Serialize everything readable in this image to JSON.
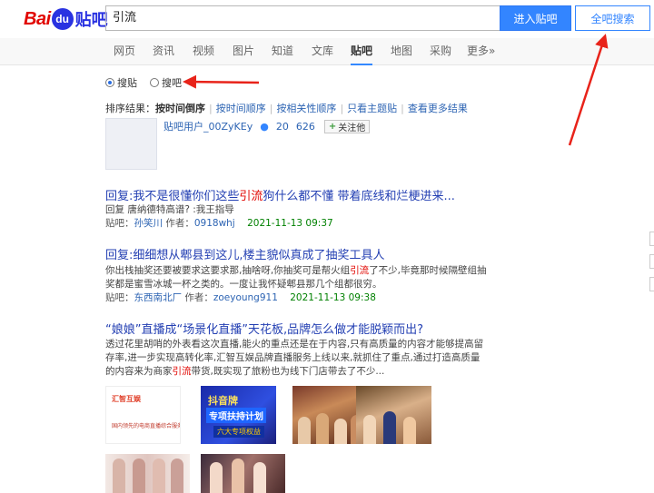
{
  "header": {
    "logo_left": "Bai",
    "logo_paw": "du",
    "logo_right": "贴吧",
    "search_value": "引流",
    "search_button": "进入贴吧",
    "all_search_button": "全吧搜索"
  },
  "nav": {
    "items": [
      "网页",
      "资讯",
      "视频",
      "图片",
      "知道",
      "文库",
      "贴吧",
      "地图",
      "采购",
      "更多»"
    ],
    "active": "贴吧"
  },
  "radios": [
    {
      "label": "搜贴",
      "checked": true
    },
    {
      "label": "搜吧",
      "checked": false
    }
  ],
  "sort": {
    "label": "排序结果：",
    "current": "按时间倒序",
    "links": [
      "按时间顺序",
      "按相关性顺序",
      "只看主题贴",
      "查看更多结果"
    ]
  },
  "user": {
    "name": "贴吧用户_00ZyKEy",
    "count1": "20",
    "count2": "626",
    "follow": "关注他"
  },
  "results": [
    {
      "title_pre": "回复:我不是很懂你们这些",
      "title_hl": "引流",
      "title_post": "狗什么都不懂 带着底线和烂梗进来...",
      "snippet": "回复 唐纳德特高谱? :我王指导",
      "meta_prefix": "贴吧：",
      "forum": "孙笑川",
      "author_prefix": "作者：",
      "author": "0918whj",
      "time": "2021-11-13 09:37"
    },
    {
      "title": "回复:细细想从郫县到这儿,楼主貌似真成了抽奖工具人",
      "snippet1_pre": "你出栈抽奖还要被要求这要求那,抽啥呀,你抽奖可是帮火组",
      "snippet1_hl": "引流",
      "snippet1_post": "了不少,毕竟那时候隔壁组抽",
      "snippet2": "奖都是蜜雪冰城一杯之类的。一度让我怀疑郫县那几个组都很穷。",
      "meta_prefix": "贴吧：",
      "forum": "东西南北厂",
      "author_prefix": "作者：",
      "author": "zoeyoung911",
      "time": "2021-11-13 09:38"
    },
    {
      "title": "“娘娘”直播成“场景化直播”天花板,品牌怎么做才能脱颖而出?",
      "snippet1": "透过花里胡哨的外表看这次直播,能火的重点还是在于内容,只有高质量的内容才能够提高留",
      "snippet2": "存率,进一步实现高转化率,汇智互娱品牌直播服务上线以来,就抓住了重点,通过打造高质量",
      "snippet3_pre": "的内容来为商家",
      "snippet3_hl": "引流",
      "snippet3_post": "带货,既实现了旅粉也为线下门店带去了不少..."
    }
  ],
  "thumbs": {
    "t1_title": "汇智互娱",
    "t1_sub": "国内领先的电商直播综合服务平台",
    "t2_big": "抖音牌",
    "t2_mid": "专项扶持计划",
    "t2_low": "六大专项权益"
  },
  "colors": {
    "accent": "#3385ff",
    "link": "#2440b3",
    "highlight": "#e10601",
    "date": "#008000",
    "annotation": "#e8231a"
  }
}
